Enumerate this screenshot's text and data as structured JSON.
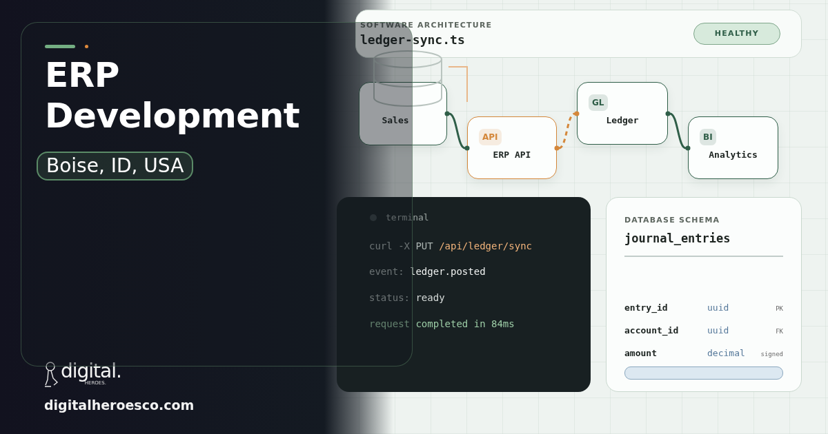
{
  "hero": {
    "title": "ERP Development",
    "location": "Boise, ID, USA"
  },
  "brand": {
    "wordmark": "digital.",
    "tagline": "HEROES.",
    "url": "digitalheroesco.com"
  },
  "header": {
    "label": "SOFTWARE ARCHITECTURE",
    "file": "ledger-sync.ts",
    "status": "HEALTHY"
  },
  "nodes": [
    {
      "kind": "database",
      "label": "Sales",
      "color": "#2f5e48"
    },
    {
      "kind": "service",
      "badge": "API",
      "label": "ERP API",
      "color": "#d4873a"
    },
    {
      "kind": "service",
      "badge": "GL",
      "label": "Ledger",
      "color": "#2f5e48"
    },
    {
      "kind": "service",
      "badge": "BI",
      "label": "Analytics",
      "color": "#2f5e48"
    }
  ],
  "connectors": [
    {
      "kind": "solid",
      "color": "#2f5e48"
    },
    {
      "kind": "dashed",
      "color": "#d4873a"
    },
    {
      "kind": "solid",
      "color": "#2f5e48"
    }
  ],
  "terminal": {
    "title": "terminal",
    "lines": [
      [
        {
          "text": "curl -X PUT ",
          "kind": "command"
        },
        {
          "text": "/api/ledger/sync",
          "kind": "path"
        }
      ],
      [
        {
          "text": "event: ",
          "kind": "key"
        },
        {
          "text": "ledger.posted",
          "kind": "value"
        }
      ],
      [
        {
          "text": "status: ",
          "kind": "key"
        },
        {
          "text": "ready",
          "kind": "state"
        }
      ],
      [
        {
          "text": "request completed in 84ms",
          "kind": "result"
        }
      ]
    ]
  },
  "schema": {
    "label": "DATABASE SCHEMA",
    "table": "journal_entries",
    "columns": [
      {
        "name": "entry_id",
        "type": "uuid",
        "tag": "PK"
      },
      {
        "name": "account_id",
        "type": "uuid",
        "tag": "FK"
      },
      {
        "name": "amount",
        "type": "decimal",
        "tag": "signed"
      }
    ]
  }
}
